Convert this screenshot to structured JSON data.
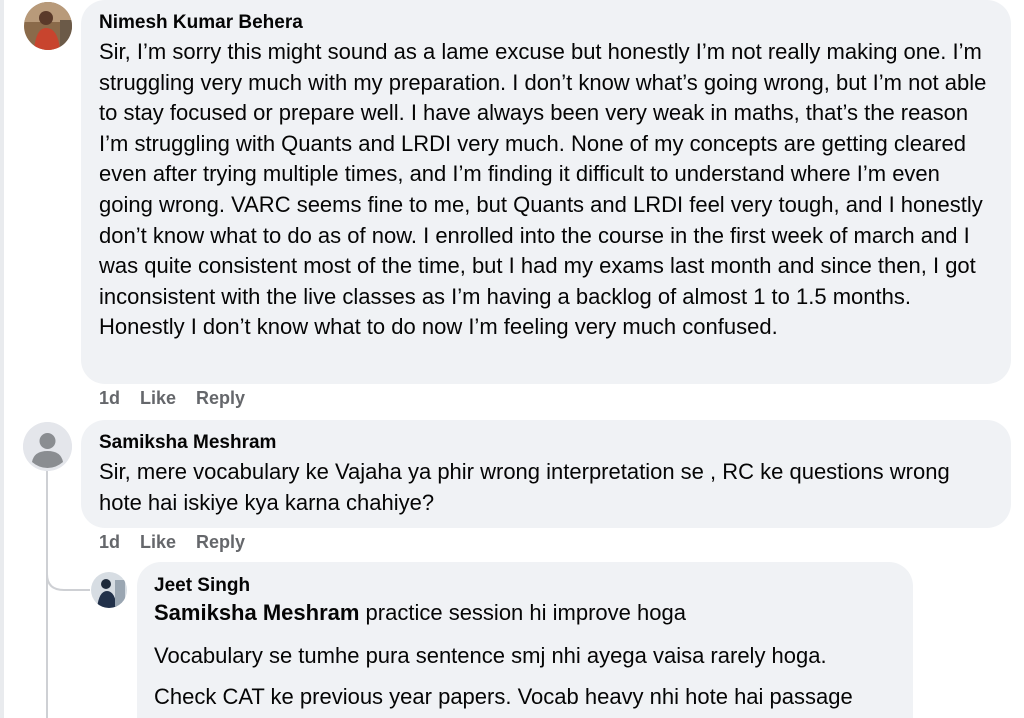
{
  "comments": [
    {
      "author": "Nimesh Kumar Behera",
      "text": "Sir, I’m sorry this might sound as a lame excuse but honestly I’m not really making one. I’m struggling very much with my preparation. I don’t know what’s going wrong, but I’m not able to stay focused or prepare well. I have always been very weak in maths, that’s the reason I’m struggling with Quants and LRDI very much. None of my concepts are getting cleared even after trying multiple times, and I’m finding it difficult to understand where I’m even going wrong. VARC seems fine to me, but Quants and LRDI feel very tough, and I honestly don’t know what to do as of now. I enrolled into the course in the first week of march and I was quite consistent most of the time, but I had my exams last month and since then, I got inconsistent with the live classes as I’m having a backlog of almost 1 to 1.5 months. Honestly I don’t know what to do now I’m feeling very much confused.",
      "time": "1d",
      "like": "Like",
      "reply": "Reply"
    },
    {
      "author": "Samiksha Meshram",
      "text": "Sir, mere vocabulary ke Vajaha ya phir wrong interpretation se , RC ke questions wrong hote hai iskiye kya karna chahiye?",
      "time": "1d",
      "like": "Like",
      "reply": "Reply"
    }
  ],
  "reply": {
    "author": "Jeet Singh",
    "mention": "Samiksha Meshram",
    "line1": " practice session hi improve hoga",
    "line2": "Vocabulary se tumhe pura sentence smj nhi ayega vaisa rarely hoga.",
    "line3": "Check CAT ke previous year papers. Vocab heavy nhi hote hai passage"
  },
  "colors": {
    "bubble": "#f0f2f5",
    "meta": "#65676b",
    "text": "#050505"
  }
}
